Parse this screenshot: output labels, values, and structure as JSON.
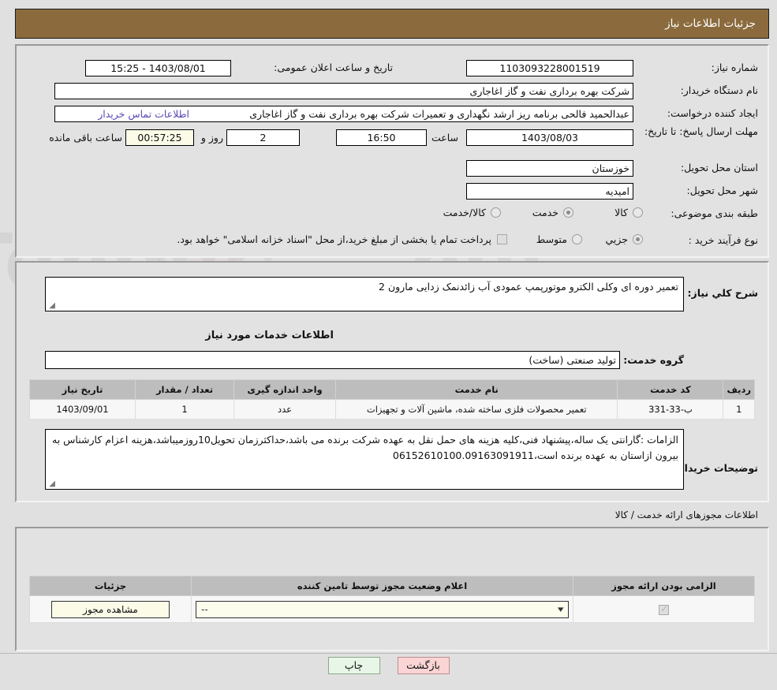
{
  "header": {
    "title": "جزئیات اطلاعات نیاز"
  },
  "top_form": {
    "need_number": {
      "label": "شماره نیاز:",
      "value": "1103093228001519"
    },
    "announce_datetime": {
      "label": "تاریخ و ساعت اعلان عمومی:",
      "value": "1403/08/01 - 15:25"
    },
    "buyer_org": {
      "label": "نام دستگاه خریدار:",
      "value": "شرکت بهره برداری نفت و گاز اغاجاری"
    },
    "request_creator": {
      "label": "ایجاد کننده درخواست:",
      "value": "عبدالحمید فالحی برنامه ریز ارشد نگهداری و تعمیرات شرکت بهره برداری نفت و گاز اغاجاری",
      "contact_link": "اطلاعات تماس خریدار"
    },
    "deadline": {
      "label": "مهلت ارسال پاسخ: تا تاریخ:",
      "date": "1403/08/03",
      "hour_label": "ساعت",
      "time": "16:50",
      "days_value": "2",
      "days_label": "روز و",
      "countdown": "00:57:25",
      "remaining_label": "ساعت باقی مانده"
    },
    "province": {
      "label": "استان محل تحویل:",
      "value": "خوزستان"
    },
    "city": {
      "label": "شهر محل تحویل:",
      "value": "امیدیه"
    },
    "category": {
      "label": "طبقه بندی موضوعی:",
      "options": [
        "کالا",
        "خدمت",
        "کالا/خدمت"
      ],
      "selected": "خدمت"
    },
    "purchase_type": {
      "label": "نوع فرآیند خرید :",
      "options": [
        "جزیي",
        "متوسط"
      ],
      "selected": "جزیي",
      "treasury_checkbox_label": "پرداخت تمام یا بخشی از مبلغ خرید،از محل \"اسناد خزانه اسلامی\" خواهد بود.",
      "treasury_checked": false
    }
  },
  "middle": {
    "general_desc": {
      "label": "شرح کلي نیاز:",
      "value": "تعمیر دوره ای وکلی الکترو موتورپمپ عمودی آب زائدنمک زدایی مارون 2"
    },
    "services_section_title": "اطلاعات خدمات مورد نیاز",
    "service_group": {
      "label": "گروه خدمت:",
      "value": "تولید صنعتی (ساخت)"
    },
    "items_table": {
      "columns": [
        "ردیف",
        "کد خدمت",
        "نام خدمت",
        "واحد اندازه گیری",
        "تعداد / مقدار",
        "تاریخ نیاز"
      ],
      "rows": [
        {
          "row": "1",
          "code": "ب-33-331",
          "name": "تعمیر محصولات فلزی ساخته شده، ماشین آلات و تجهیزات",
          "unit": "عدد",
          "qty": "1",
          "date": "1403/09/01"
        }
      ]
    },
    "buyer_notes": {
      "label": "توضیحات خریدار:",
      "value": "الزامات :گارانتی یک ساله،پیشنهاد فنی،کلیه هزینه های حمل نقل به عهده شرکت برنده می باشد،حداکثرزمان تحویل10روزمیباشد،هزینه اعزام کارشناس به بیرون ازاستان به عهده برنده است،06152610100.09163091911"
    }
  },
  "permits": {
    "section_title": "اطلاعات مجوزهای ارائه خدمت / کالا",
    "columns": [
      "الزامی بودن ارائه مجوز",
      "اعلام وضعیت مجوز توسط تامین کننده",
      "جزئیات"
    ],
    "rows": [
      {
        "required_checked": true,
        "status_value": "--",
        "details_button": "مشاهده مجوز"
      }
    ]
  },
  "footer": {
    "print_label": "چاپ",
    "back_label": "بازگشت"
  },
  "colors": {
    "header_brown": "#8b6b3d",
    "link_purple": "#5a47b4",
    "page_bg": "#e0e0e0",
    "panel_bg": "#e2e2e2",
    "table_header": "#bdbdbd",
    "print_btn": "#e8f6e8",
    "back_btn": "#fbd5d5",
    "timer_bg": "#fbfbe8"
  }
}
